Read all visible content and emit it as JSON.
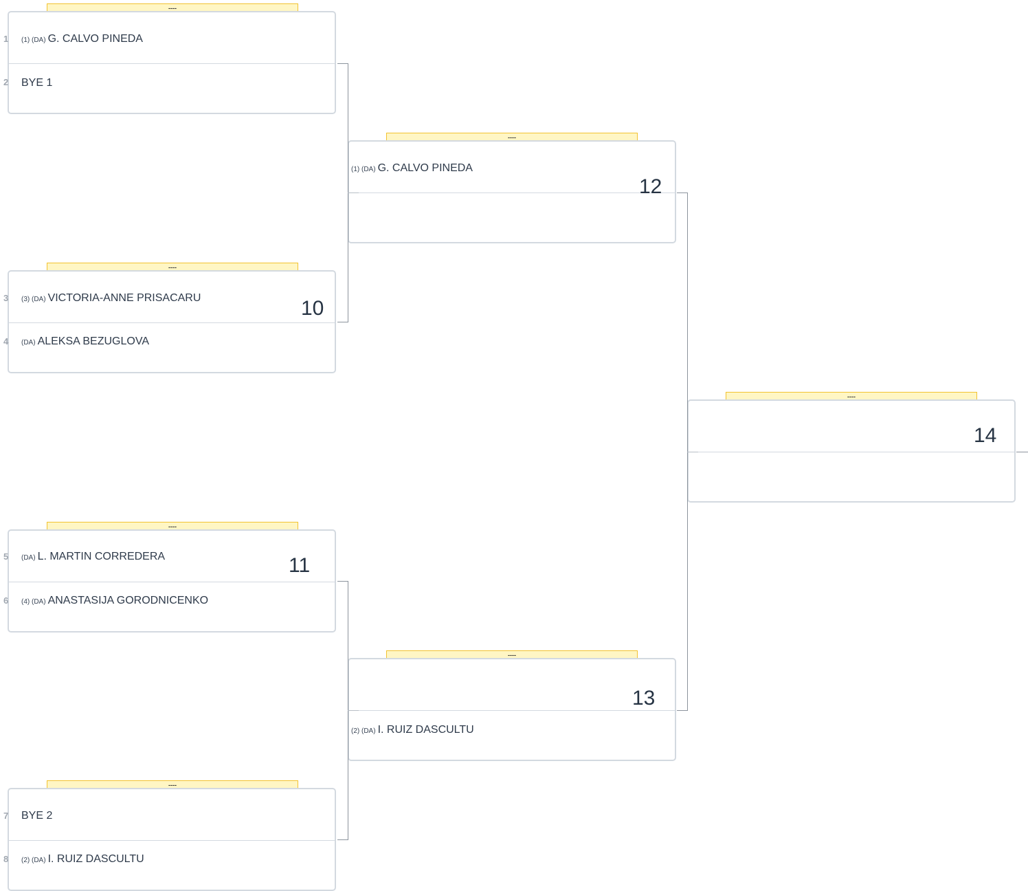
{
  "header_placeholder": "----",
  "round1": [
    {
      "seed": "1",
      "tags": "(1) (DA)",
      "name": "G. CALVO PINEDA"
    },
    {
      "seed": "2",
      "tags": "",
      "name": "BYE 1"
    },
    {
      "seed": "3",
      "tags": "(3) (DA)",
      "name": "VICTORIA-ANNE PRISACARU"
    },
    {
      "seed": "4",
      "tags": "(DA)",
      "name": "ALEKSA BEZUGLOVA"
    },
    {
      "seed": "5",
      "tags": "(DA)",
      "name": "L. MARTIN CORREDERA"
    },
    {
      "seed": "6",
      "tags": "(4) (DA)",
      "name": "ANASTASIJA GORODNICENKO"
    },
    {
      "seed": "7",
      "tags": "",
      "name": "BYE 2"
    },
    {
      "seed": "8",
      "tags": "(2) (DA)",
      "name": "I. RUIZ DASCULTU"
    }
  ],
  "match_numbers": {
    "m10": "10",
    "m11": "11",
    "m12": "12",
    "m13": "13",
    "m14": "14"
  },
  "round2": {
    "m12_top": {
      "tags": "(1) (DA)",
      "name": "G. CALVO PINEDA"
    },
    "m13_bottom": {
      "tags": "(2) (DA)",
      "name": "I. RUIZ DASCULTU"
    }
  },
  "colors": {
    "header_fill": "#fff6c4",
    "header_border": "#f2c230",
    "card_border": "#d3d9e0",
    "text": "#2e3a4a"
  }
}
